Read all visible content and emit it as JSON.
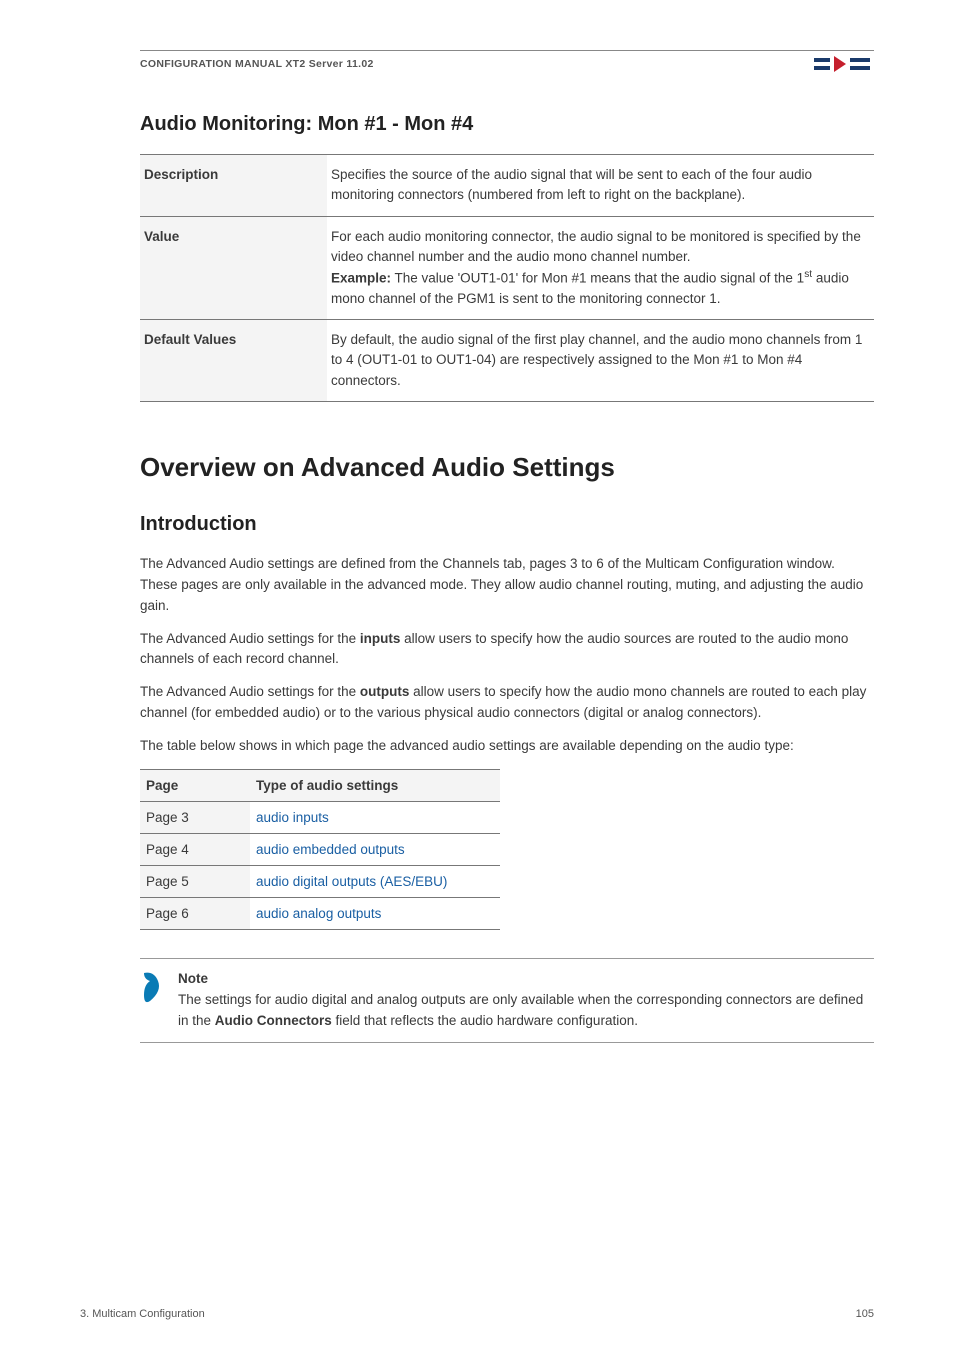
{
  "header": {
    "title": "CONFIGURATION MANUAL   XT2 Server 11.02"
  },
  "section1": {
    "heading": "Audio Monitoring: Mon #1 - Mon #4"
  },
  "spec_table": [
    {
      "label": "Description",
      "value_html": "Specifies the source of the audio signal that will be sent to each of the four audio monitoring connectors (numbered from left to right on the backplane)."
    },
    {
      "label": "Value",
      "value_html": "For each audio monitoring connector, the audio signal to be monitored is specified by the video channel number and the audio mono channel number.<br><b>Example:</b> The value 'OUT1-01' for Mon #1 means that the audio signal of the 1<sup>st</sup> audio mono channel of the PGM1 is sent to the monitoring connector 1."
    },
    {
      "label": "Default Values",
      "value_html": "By default, the audio signal of the first play channel, and the audio mono channels from 1 to 4 (OUT1-01 to OUT1-04) are respectively assigned to the Mon #1 to Mon #4 connectors."
    }
  ],
  "section2": {
    "heading": "Overview on Advanced Audio Settings",
    "sub": "Introduction",
    "p1": "The Advanced Audio settings are defined from the Channels tab, pages 3 to 6 of the Multicam Configuration window. These pages are only available in the advanced mode. They allow audio channel routing, muting, and adjusting the audio gain.",
    "p2_html": "The Advanced Audio settings for the <b>inputs</b> allow users to specify how the audio sources are routed to the audio mono channels of each record channel.",
    "p3_html": "The Advanced Audio settings for the <b>outputs</b> allow users to specify how the audio mono channels are routed to each play channel (for embedded audio) or to the various physical audio connectors (digital or analog connectors).",
    "p4": "The table below shows in which page the advanced audio settings are available depending on the audio type:"
  },
  "pages_table": {
    "headers": [
      "Page",
      "Type of audio settings"
    ],
    "rows": [
      {
        "page": "Page 3",
        "link": "audio inputs"
      },
      {
        "page": "Page 4",
        "link": "audio embedded outputs"
      },
      {
        "page": "Page 5",
        "link": "audio digital outputs (AES/EBU)"
      },
      {
        "page": "Page 6",
        "link": "audio analog outputs"
      }
    ]
  },
  "note": {
    "title": "Note",
    "body_html": "The settings for audio digital and analog outputs are only available when the corresponding connectors are defined in the <b>Audio Connectors</b> field that reflects the audio hardware configuration."
  },
  "footer": {
    "left": "3. Multicam Configuration",
    "right": "105"
  }
}
